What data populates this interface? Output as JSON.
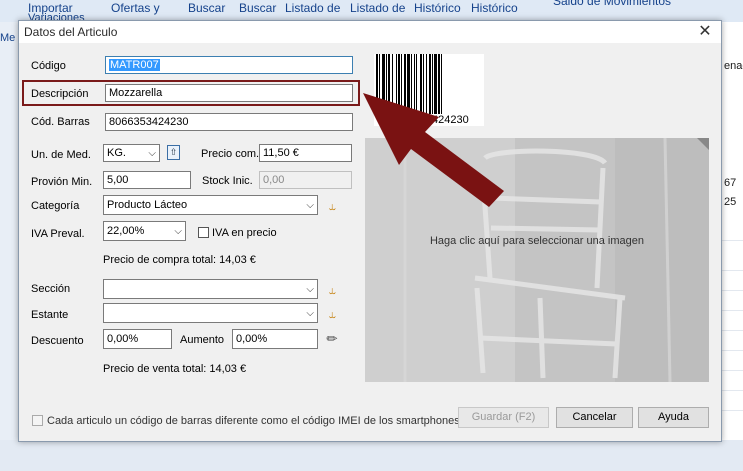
{
  "background": {
    "ribbon": {
      "items_top": [
        "Importar",
        "Ofertas y",
        "Buscar",
        "Buscar",
        "Listado de",
        "Listado de",
        "Histórico",
        "Histórico",
        "Saldo de Movimientos"
      ],
      "items_sub": [
        "Variaciones",
        "Me"
      ]
    },
    "right_column": {
      "header": "enac",
      "values": [
        "67",
        "25"
      ]
    }
  },
  "dialog": {
    "title": "Datos del Articulo",
    "fields": {
      "codigo": {
        "label": "Código",
        "value": "MATR007"
      },
      "descripcion": {
        "label": "Descripción",
        "value": "Mozzarella"
      },
      "cod_barras": {
        "label": "Cód. Barras",
        "value": "8066353424230"
      },
      "un_med": {
        "label": "Un. de Med.",
        "value": "KG."
      },
      "precio_com": {
        "label": "Precio com.",
        "value": "11,50 €"
      },
      "provision_min": {
        "label": "Provión Min.",
        "value": "5,00"
      },
      "stock_inic": {
        "label": "Stock Inic.",
        "value": "0,00"
      },
      "categoria": {
        "label": "Categoría",
        "value": "Producto Lácteo"
      },
      "iva_preval": {
        "label": "IVA Preval.",
        "value": "22,00%"
      },
      "iva_en_precio": {
        "label": "IVA en precio"
      },
      "precio_compra_total": "Precio de compra total: 14,03 €",
      "seccion": {
        "label": "Sección",
        "value": ""
      },
      "estante": {
        "label": "Estante",
        "value": ""
      },
      "descuento": {
        "label": "Descuento",
        "value": "0,00%"
      },
      "aumento": {
        "label": "Aumento",
        "value": "0,00%"
      },
      "precio_venta_total": "Precio de venta total: 14,03 €"
    },
    "barcode_number": "8066353424230",
    "image_hint": "Haga clic aquí para seleccionar una imagen",
    "imei_checkbox_label": "Cada articulo un código de barras diferente como el código IMEI de los smartphones",
    "buttons": {
      "guardar": "Guardar (F2)",
      "cancelar": "Cancelar",
      "ayuda": "Ayuda"
    },
    "colors": {
      "highlight_box": "#7a1a1a",
      "arrow": "#7a1212",
      "selection": "#3399ff"
    }
  }
}
